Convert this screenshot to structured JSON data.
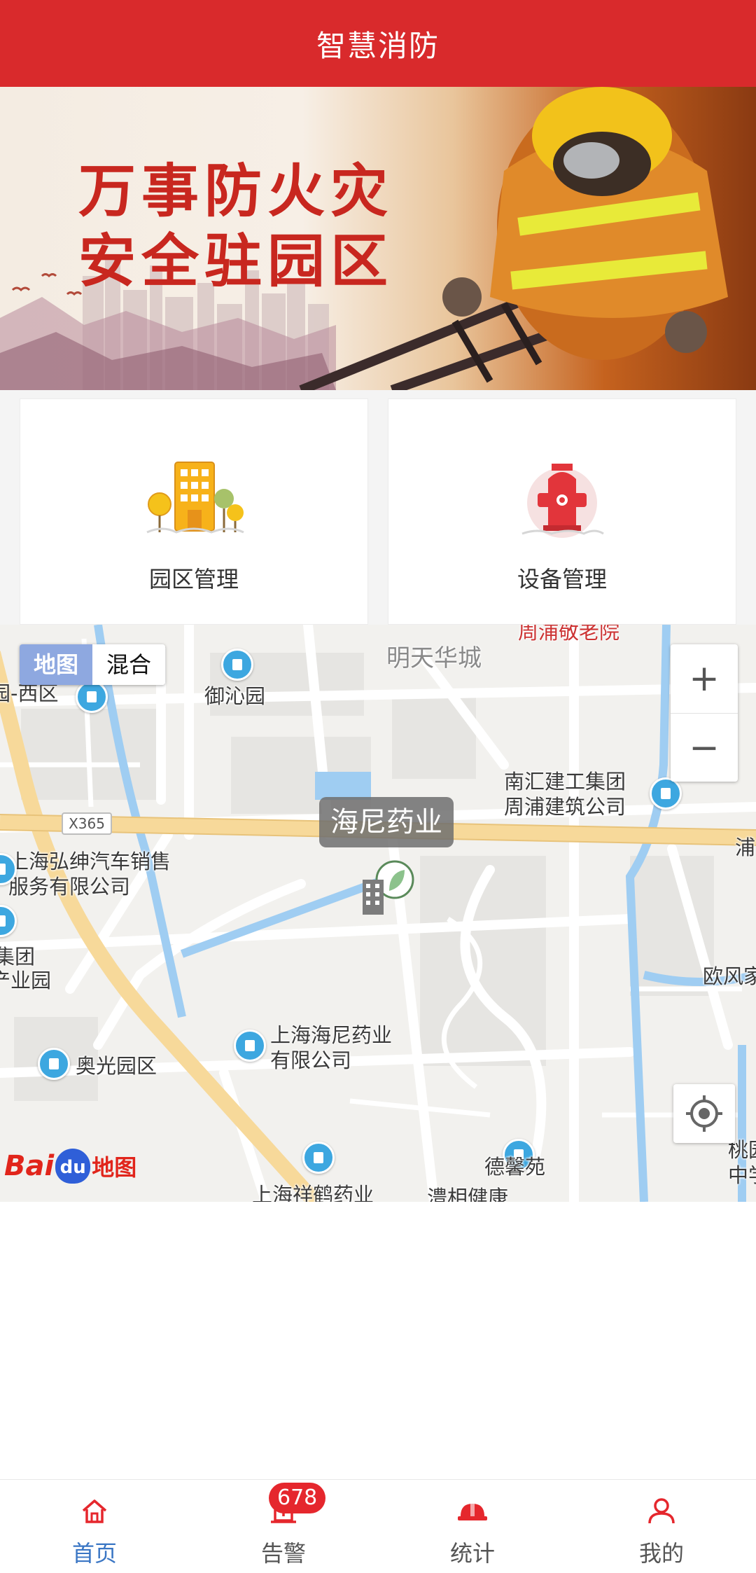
{
  "header": {
    "title": "智慧消防"
  },
  "banner": {
    "line1": "万事防火灾",
    "line2": "安全驻园区"
  },
  "cards": [
    {
      "label": "园区管理",
      "icon": "park-building-icon"
    },
    {
      "label": "设备管理",
      "icon": "fire-hydrant-icon"
    }
  ],
  "map": {
    "type_buttons": {
      "map": "地图",
      "hybrid": "混合"
    },
    "zoom": {
      "in": "+",
      "out": "−"
    },
    "road_shield": "X365",
    "company_tag": "海尼药业",
    "labels": {
      "mingtian": "明天华城",
      "yuqin": "御沁园",
      "xiqu": "园-西区",
      "nanhui": "南汇建工集团",
      "zhoupu_build": "周浦建筑公司",
      "pu": "浦",
      "hongshen1": "上海弘绅汽车销售",
      "hongshen2": "服务有限公司",
      "jituan": "集团",
      "yeyuan": "产业园",
      "oufeng": "欧风家",
      "haini1": "上海海尼药业",
      "haini2": "有限公司",
      "aoguang": "奥光园区",
      "dexin": "德馨苑",
      "tao1": "桃园",
      "tao2": "中学",
      "xianghe": "上海祥鹤药业",
      "lixiang": "澧相健康",
      "top_cut": "周浦敬老院"
    },
    "logo": {
      "bai": "Bai",
      "du": "du",
      "ditu": "地图"
    }
  },
  "tabbar": [
    {
      "label": "首页",
      "icon": "home-icon",
      "active": true
    },
    {
      "label": "告警",
      "icon": "alarm-icon",
      "badge": "678"
    },
    {
      "label": "统计",
      "icon": "helmet-icon"
    },
    {
      "label": "我的",
      "icon": "user-icon"
    }
  ],
  "colors": {
    "primary_red": "#d92a2c",
    "tab_active": "#3a76c4",
    "badge": "#e5272d"
  }
}
